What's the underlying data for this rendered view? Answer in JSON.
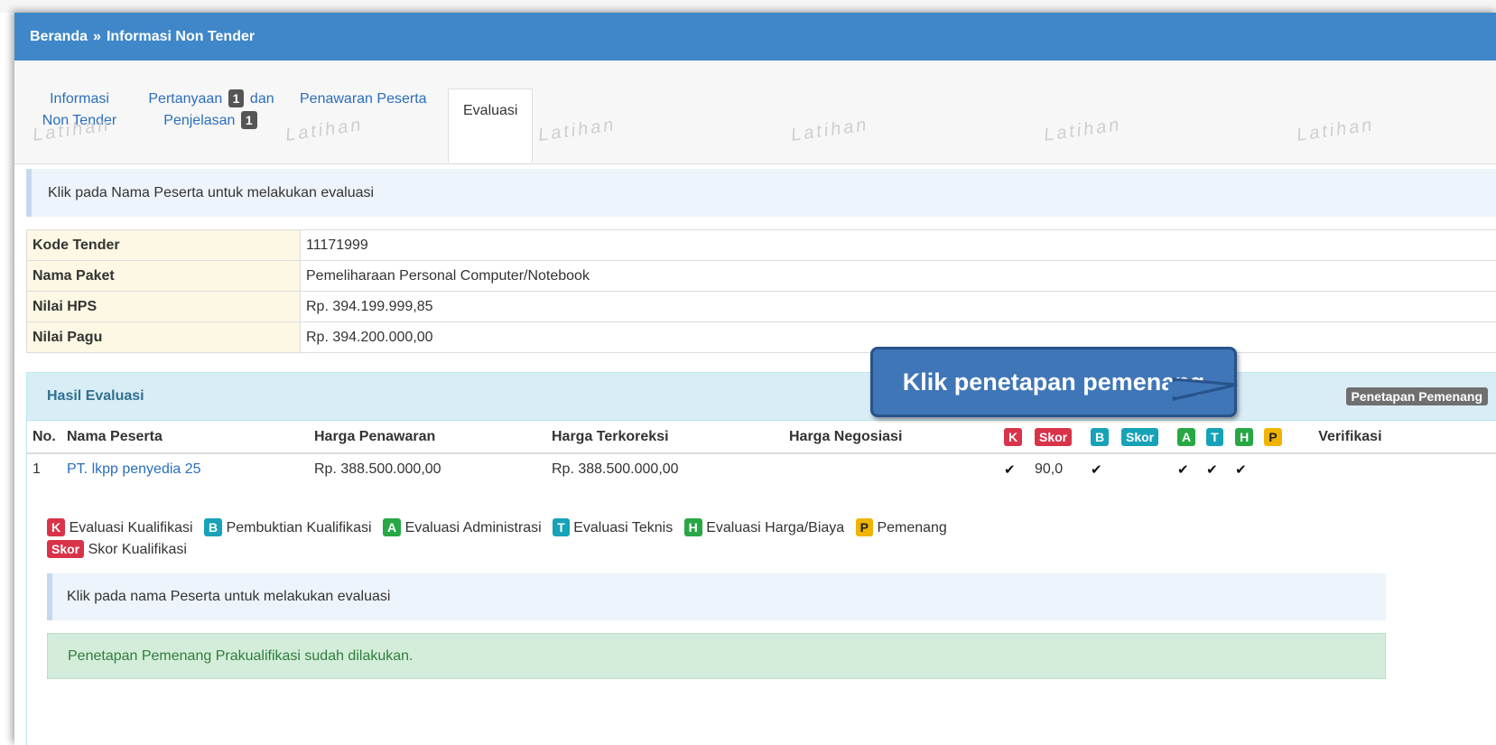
{
  "breadcrumb": {
    "home": "Beranda",
    "separator": "»",
    "current": "Informasi Non Tender"
  },
  "tabs": {
    "informasi_line1": "Informasi",
    "informasi_line2": "Non Tender",
    "pertanyaan_label": "Pertanyaan",
    "pertanyaan_badge": "1",
    "pertanyaan_dan": "dan",
    "penjelasan_label": "Penjelasan",
    "penjelasan_badge": "1",
    "penawaran": "Penawaran Peserta",
    "evaluasi": "Evaluasi"
  },
  "watermark": "Latihan",
  "info_callout": "Klik pada Nama Peserta untuk melakukan evaluasi",
  "info_table": [
    {
      "key": "Kode Tender",
      "value": "11171999"
    },
    {
      "key": "Nama Paket",
      "value": "Pemeliharaan Personal Computer/Notebook"
    },
    {
      "key": "Nilai HPS",
      "value": "Rp. 394.199.999,85"
    },
    {
      "key": "Nilai Pagu",
      "value": "Rp. 394.200.000,00"
    }
  ],
  "panel": {
    "title": "Hasil Evaluasi",
    "button": "Penetapan Pemenang"
  },
  "results": {
    "headers": {
      "no": "No.",
      "nama": "Nama Peserta",
      "harga_penawaran": "Harga Penawaran",
      "harga_terkoreksi": "Harga Terkoreksi",
      "harga_negosiasi": "Harga Negosiasi",
      "k": "K",
      "skor1": "Skor",
      "b": "B",
      "skor2": "Skor",
      "a": "A",
      "t": "T",
      "h": "H",
      "p": "P",
      "verifikasi": "Verifikasi"
    },
    "rows": [
      {
        "no": "1",
        "nama": "PT. lkpp penyedia 25",
        "harga_penawaran": "Rp. 388.500.000,00",
        "harga_terkoreksi": "Rp. 388.500.000,00",
        "harga_negosiasi": "",
        "skor": "90,0"
      }
    ]
  },
  "legend": {
    "k": "K",
    "k_text": "Evaluasi Kualifikasi",
    "b": "B",
    "b_text": "Pembuktian Kualifikasi",
    "a": "A",
    "a_text": "Evaluasi Administrasi",
    "t": "T",
    "t_text": "Evaluasi Teknis",
    "h": "H",
    "h_text": "Evaluasi Harga/Biaya",
    "p": "P",
    "p_text": "Pemenang",
    "skor": "Skor",
    "skor_text": "Skor Kualifikasi"
  },
  "note": "Klik pada nama Peserta untuk melakukan evaluasi",
  "success": "Penetapan Pemenang Prakualifikasi sudah dilakukan.",
  "callout": "Klik penetapan pemenang",
  "colors": {
    "header_blue": "#3f87c9",
    "k_red": "#d9334a",
    "b_teal": "#17a2b8",
    "a_green": "#28a745",
    "p_yellow": "#f0b400"
  }
}
